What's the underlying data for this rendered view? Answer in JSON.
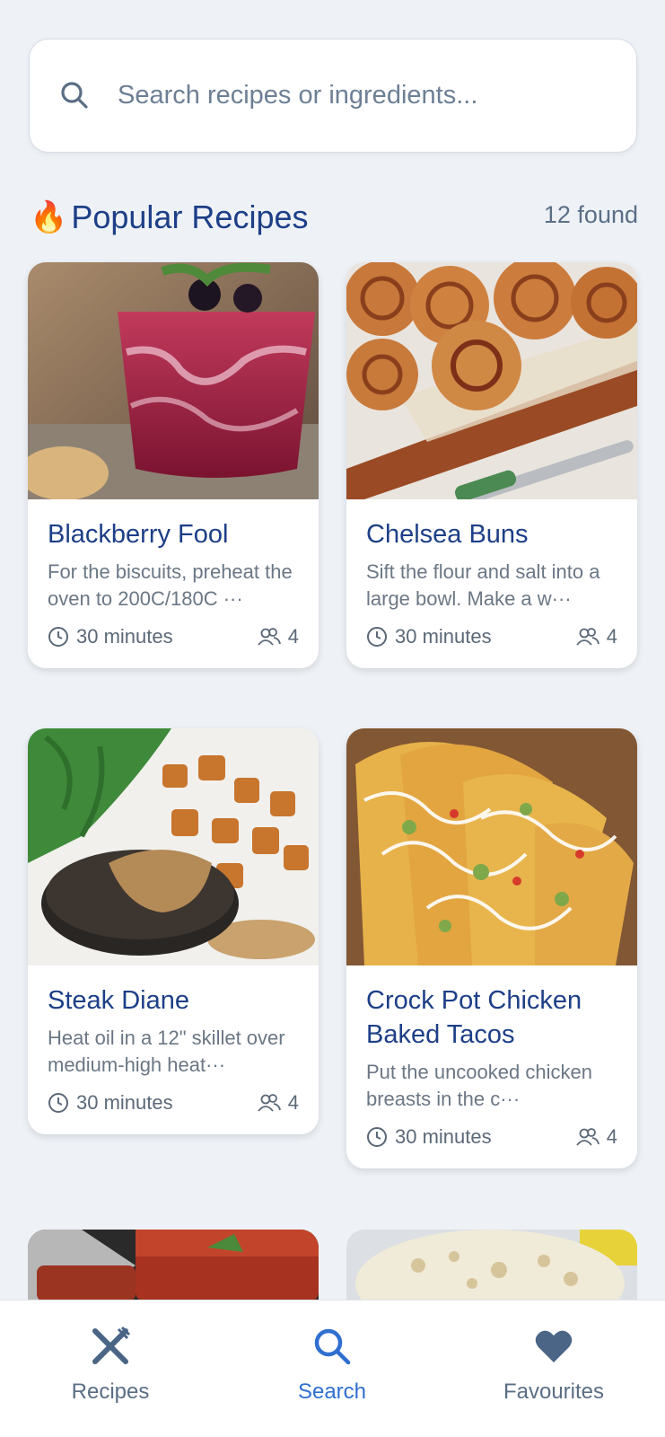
{
  "search": {
    "placeholder": "Search recipes or ingredients..."
  },
  "section": {
    "icon": "fire-icon",
    "title": "Popular Recipes",
    "count": "12 found"
  },
  "recipes": [
    {
      "title": "Blackberry Fool",
      "description": "For the biscuits, preheat the oven to 200C/180C ···",
      "time": "30 minutes",
      "servings": "4"
    },
    {
      "title": "Chelsea Buns",
      "description": "Sift the flour and salt into a large bowl. Make a w···",
      "time": "30 minutes",
      "servings": "4"
    },
    {
      "title": "Steak Diane",
      "description": "Heat oil in a 12\" skillet over medium-high heat···",
      "time": "30 minutes",
      "servings": "4"
    },
    {
      "title": "Crock Pot Chicken Baked Tacos",
      "description": "Put the uncooked chicken breasts in the c···",
      "time": "30 minutes",
      "servings": "4"
    }
  ],
  "nav": [
    {
      "label": "Recipes",
      "icon": "fork-knife-icon",
      "active": false
    },
    {
      "label": "Search",
      "icon": "search-icon",
      "active": true
    },
    {
      "label": "Favourites",
      "icon": "heart-icon",
      "active": false
    }
  ],
  "colors": {
    "background": "#eef2f7",
    "title": "#1d3f87",
    "active": "#2f6fd0",
    "muted": "#5b6e86"
  }
}
